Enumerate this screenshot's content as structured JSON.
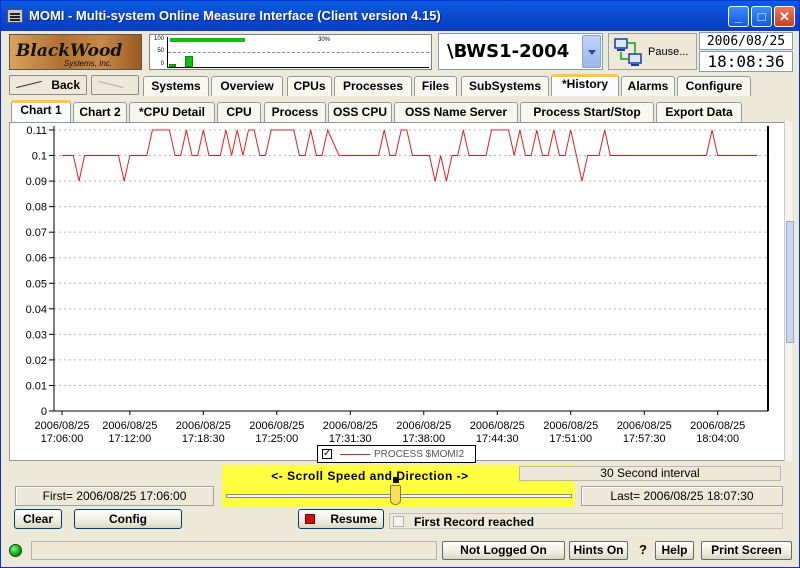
{
  "window": {
    "title": "MOMI - Multi-system Online Measure Interface (Client version 4.15)",
    "minimize": "_",
    "maximize": "□",
    "close": "✕"
  },
  "logo": {
    "brand": "BlackWood",
    "sub": "Systems, Inc."
  },
  "mini_chart": {
    "axis": [
      "100",
      "50",
      "0"
    ],
    "progress_label": "30%",
    "progress": 0.3
  },
  "system": {
    "selected": "\\BWS1-2004"
  },
  "pause": {
    "label": "Pause..."
  },
  "datetime": {
    "date": "2006/08/25",
    "time": "18:08:36"
  },
  "nav": {
    "back": "Back"
  },
  "main_tabs": [
    "Systems",
    "Overview",
    "CPUs",
    "Processes",
    "Files",
    "SubSystems",
    "*History",
    "Alarms",
    "Configure"
  ],
  "sub_tabs": [
    "Chart 1",
    "Chart 2",
    "*CPU Detail",
    "CPU",
    "Process",
    "OSS CPU",
    "OSS Name Server",
    "Process Start/Stop",
    "Export Data"
  ],
  "chart_data": {
    "type": "line",
    "ylim": [
      0,
      0.11
    ],
    "y_ticks": [
      "0",
      "0.01",
      "0.02",
      "0.03",
      "0.04",
      "0.05",
      "0.06",
      "0.07",
      "0.08",
      "0.09",
      "0.1",
      "0.11"
    ],
    "x_ticks": [
      {
        "date": "2006/08/25",
        "time": "17:06:00"
      },
      {
        "date": "2006/08/25",
        "time": "17:12:00"
      },
      {
        "date": "2006/08/25",
        "time": "17:18:30"
      },
      {
        "date": "2006/08/25",
        "time": "17:25:00"
      },
      {
        "date": "2006/08/25",
        "time": "17:31:30"
      },
      {
        "date": "2006/08/25",
        "time": "17:38:00"
      },
      {
        "date": "2006/08/25",
        "time": "17:44:30"
      },
      {
        "date": "2006/08/25",
        "time": "17:51:00"
      },
      {
        "date": "2006/08/25",
        "time": "17:57:30"
      },
      {
        "date": "2006/08/25",
        "time": "18:04:00"
      }
    ],
    "grid": true,
    "series": [
      {
        "name": "PROCESS $MOMI2",
        "color": "#e02020",
        "x": [
          "17:06:00",
          "17:07:00",
          "17:07:30",
          "17:08:00",
          "17:11:00",
          "17:11:30",
          "17:12:00",
          "17:13:30",
          "17:14:00",
          "17:15:30",
          "17:16:00",
          "17:16:30",
          "17:17:00",
          "17:17:30",
          "17:18:00",
          "17:18:30",
          "17:19:00",
          "17:20:00",
          "17:20:30",
          "17:21:00",
          "17:21:30",
          "17:22:00",
          "17:22:30",
          "17:23:00",
          "17:23:30",
          "17:24:00",
          "17:24:30",
          "17:25:00",
          "17:26:30",
          "17:27:00",
          "17:27:30",
          "17:28:00",
          "17:28:30",
          "17:29:00",
          "17:29:30",
          "17:30:30",
          "17:31:00",
          "17:31:30",
          "17:32:00",
          "17:34:00",
          "17:34:30",
          "17:35:00",
          "17:35:30",
          "17:36:00",
          "17:36:30",
          "17:37:00",
          "17:38:00",
          "17:38:30",
          "17:39:00",
          "17:39:30",
          "17:40:00",
          "17:40:30",
          "17:41:00",
          "17:41:30",
          "17:42:00",
          "17:43:30",
          "17:44:00",
          "17:44:30",
          "17:45:30",
          "17:46:00",
          "17:46:30",
          "17:47:00",
          "17:47:30",
          "17:48:00",
          "17:48:30",
          "17:49:00",
          "17:49:30",
          "17:50:00",
          "17:50:30",
          "17:51:00",
          "17:51:30",
          "17:52:00",
          "17:52:30",
          "17:53:30",
          "17:54:00",
          "17:54:30",
          "17:55:00",
          "17:56:00",
          "17:56:30",
          "17:57:00",
          "17:57:30",
          "17:58:00",
          "17:58:30",
          "17:59:00",
          "18:03:00",
          "18:03:30",
          "18:04:00",
          "18:06:30",
          "18:07:30"
        ],
        "values": [
          0.1,
          0.1,
          0.09,
          0.1,
          0.1,
          0.09,
          0.1,
          0.1,
          0.11,
          0.11,
          0.1,
          0.1,
          0.11,
          0.1,
          0.1,
          0.11,
          0.1,
          0.1,
          0.11,
          0.1,
          0.11,
          0.1,
          0.11,
          0.11,
          0.1,
          0.1,
          0.11,
          0.11,
          0.11,
          0.1,
          0.1,
          0.11,
          0.1,
          0.1,
          0.11,
          0.1,
          0.1,
          0.1,
          0.1,
          0.1,
          0.11,
          0.1,
          0.1,
          0.11,
          0.11,
          0.1,
          0.1,
          0.1,
          0.09,
          0.1,
          0.09,
          0.1,
          0.1,
          0.11,
          0.1,
          0.1,
          0.11,
          0.11,
          0.11,
          0.1,
          0.11,
          0.1,
          0.1,
          0.11,
          0.1,
          0.1,
          0.11,
          0.1,
          0.1,
          0.11,
          0.1,
          0.09,
          0.1,
          0.1,
          0.11,
          0.1,
          0.1,
          0.1,
          0.1,
          0.1,
          0.1,
          0.1,
          0.1,
          0.1,
          0.1,
          0.11,
          0.1,
          0.1,
          0.1
        ]
      }
    ]
  },
  "footer": {
    "first": "First= 2006/08/25 17:06:00",
    "last": "Last= 2006/08/25 18:07:30",
    "scroll_label": "<-  Scroll Speed and Direction  ->",
    "interval": "30 Second interval",
    "first_record": "First Record reached",
    "clear": "Clear",
    "config": "Config",
    "resume": "Resume"
  },
  "status": {
    "login": "Not Logged On",
    "hints": "Hints On",
    "question": "?",
    "help": "Help",
    "print": "Print Screen"
  }
}
